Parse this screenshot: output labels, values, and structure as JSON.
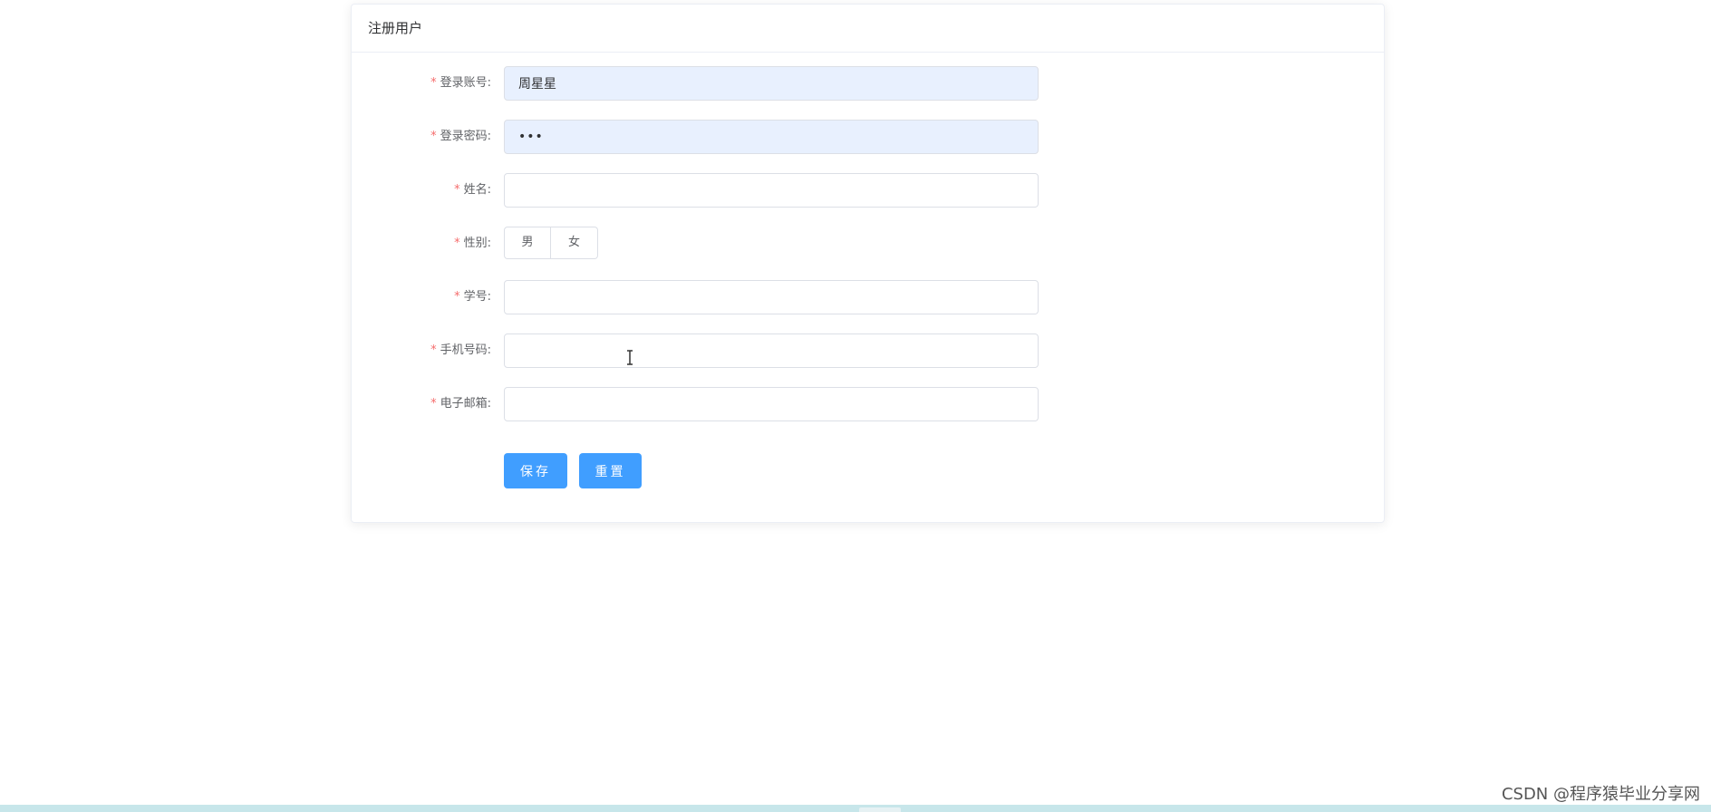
{
  "card": {
    "title": "注册用户"
  },
  "form": {
    "fields": [
      {
        "label": "登录账号:",
        "value": "周星星",
        "placeholder": ""
      },
      {
        "label": "登录密码:",
        "value": "•••",
        "placeholder": ""
      },
      {
        "label": "姓名:",
        "value": "",
        "placeholder": ""
      },
      {
        "label": "性别:",
        "options": [
          "男",
          "女"
        ]
      },
      {
        "label": "学号:",
        "value": "",
        "placeholder": ""
      },
      {
        "label": "手机号码:",
        "value": "",
        "placeholder": ""
      },
      {
        "label": "电子邮箱:",
        "value": "",
        "placeholder": ""
      }
    ],
    "required_mark": "*",
    "save_label": "保存",
    "reset_label": "重置"
  },
  "watermark": "CSDN @程序猿毕业分享网",
  "colors": {
    "primary": "#409eff",
    "required": "#f56c6c",
    "autofill": "#e8f0fe",
    "border": "#dcdfe6"
  },
  "icons": {
    "cursor": "text-cursor-icon"
  }
}
